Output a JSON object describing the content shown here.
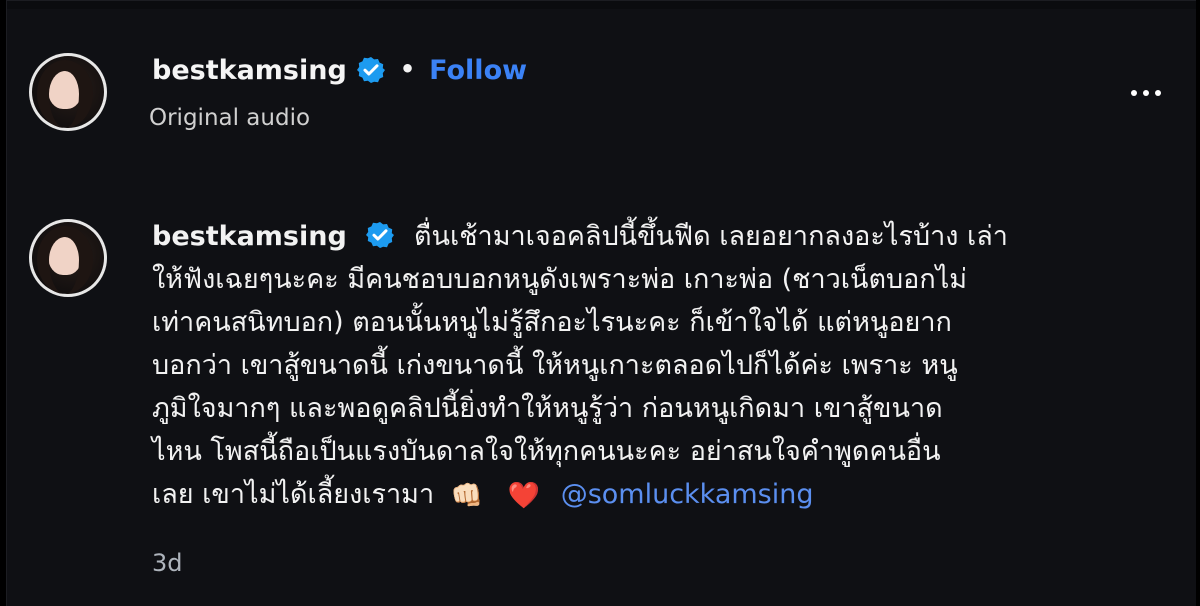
{
  "header": {
    "username": "bestkamsing",
    "separator": "•",
    "follow_label": "Follow",
    "subtitle": "Original audio",
    "more_label": "•••"
  },
  "post": {
    "username": "bestkamsing",
    "text_lines": [
      "ตื่นเช้ามาเจอคลิปนี้ขึ้นฟีด เลยอยากลงอะไรบ้าง เล่า",
      "ให้ฟังเฉยๆนะคะ มีคนชอบบอกหนูดังเพราะพ่อ เกาะพ่อ (ชาวเน็ตบอกไม่",
      "เท่าคนสนิทบอก) ตอนนั้นหนูไม่รู้สึกอะไรนะคะ ก็เข้าใจได้ แต่หนูอยาก",
      "บอกว่า เขาสู้ขนาดนี้ เก่งขนาดนี้ ให้หนูเกาะตลอดไปก็ได้ค่ะ เพราะ หนู",
      "ภูมิใจมากๆ และพอดูคลิปนี้ยิ่งทำให้หนูรู้ว่า ก่อนหนูเกิดมา เขาสู้ขนาด",
      "ไหน โพสนี้ถือเป็นแรงบันดาลใจให้ทุกคนนะคะ อย่าสนใจคำพูดคนอื่น",
      "เลย เขาไม่ได้เลี้ยงเรามา"
    ],
    "emojis": [
      "👊🏻",
      "❤️"
    ],
    "mention": "@somluckkamsing",
    "timestamp": "3d"
  },
  "colors": {
    "background": "#0f1014",
    "text": "#f2f2f2",
    "secondary_text": "#d0d0d0",
    "link": "#3b82f6",
    "verified": "#1d9bf0"
  },
  "icons": {
    "verified": "verified-badge-icon",
    "more": "more-options-icon",
    "fist_emoji": "fist-bump-emoji-icon",
    "heart_emoji": "red-heart-emoji-icon"
  }
}
